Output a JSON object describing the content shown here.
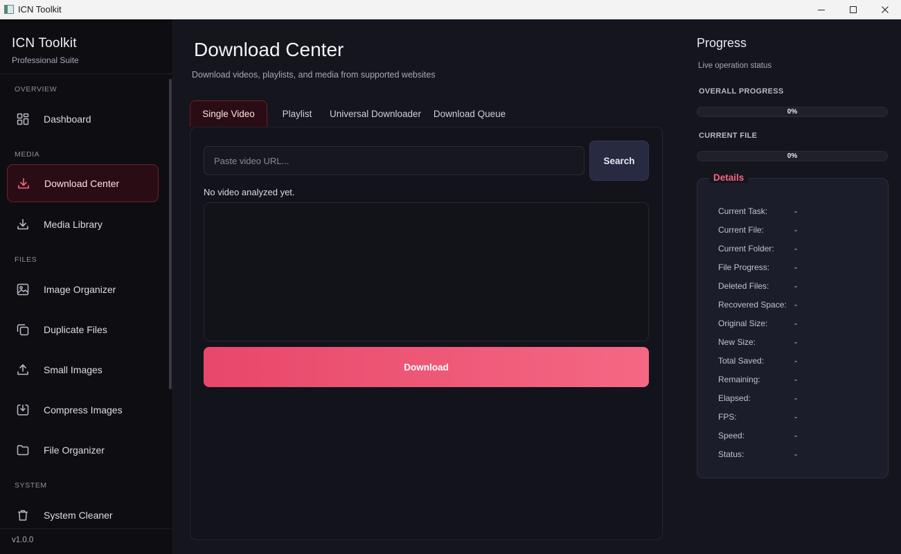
{
  "window": {
    "title": "ICN Toolkit"
  },
  "sidebar": {
    "brand_title": "ICN Toolkit",
    "brand_subtitle": "Professional Suite",
    "sections": [
      "OVERVIEW",
      "MEDIA",
      "FILES",
      "SYSTEM"
    ],
    "items": [
      {
        "label": "Dashboard",
        "icon": "dashboard-grid-icon"
      },
      {
        "label": "Download Center",
        "icon": "download-icon",
        "active": true
      },
      {
        "label": "Media Library",
        "icon": "download-icon"
      },
      {
        "label": "Image Organizer",
        "icon": "image-icon"
      },
      {
        "label": "Duplicate Files",
        "icon": "copy-icon"
      },
      {
        "label": "Small Images",
        "icon": "upload-icon"
      },
      {
        "label": "Compress Images",
        "icon": "compress-icon"
      },
      {
        "label": "File Organizer",
        "icon": "folder-icon"
      },
      {
        "label": "System Cleaner",
        "icon": "trash-icon"
      }
    ],
    "version": "v1.0.0"
  },
  "main": {
    "title": "Download Center",
    "subtitle": "Download videos, playlists, and media from supported websites",
    "tabs": [
      {
        "label": "Single Video",
        "active": true
      },
      {
        "label": "Playlist"
      },
      {
        "label": "Universal Downloader"
      },
      {
        "label": "Download Queue"
      }
    ],
    "url_placeholder": "Paste video URL...",
    "search_label": "Search",
    "status": "No video analyzed yet.",
    "download_label": "Download"
  },
  "progress": {
    "title": "Progress",
    "subtitle": "Live operation status",
    "overall_label": "OVERALL PROGRESS",
    "overall_value": 0,
    "overall_text": "0%",
    "current_label": "CURRENT FILE",
    "current_value": 0,
    "current_text": "0%",
    "details_title": "Details",
    "details": [
      {
        "key": "Current Task:",
        "value": "-"
      },
      {
        "key": "Current File:",
        "value": "-"
      },
      {
        "key": "Current Folder:",
        "value": "-"
      },
      {
        "key": "File Progress:",
        "value": "-"
      },
      {
        "key": "Deleted Files:",
        "value": "-"
      },
      {
        "key": "Recovered Space:",
        "value": "-"
      },
      {
        "key": "Original Size:",
        "value": "-"
      },
      {
        "key": "New Size:",
        "value": "-"
      },
      {
        "key": "Total Saved:",
        "value": "-"
      },
      {
        "key": "Remaining:",
        "value": "-"
      },
      {
        "key": "Elapsed:",
        "value": "-"
      },
      {
        "key": "FPS:",
        "value": "-"
      },
      {
        "key": "Speed:",
        "value": "-"
      },
      {
        "key": "Status:",
        "value": "-"
      }
    ]
  },
  "colors": {
    "accent": "#e8476a",
    "accent_light": "#f46884",
    "background": "#15151d",
    "sidebar": "#0e0e12"
  }
}
